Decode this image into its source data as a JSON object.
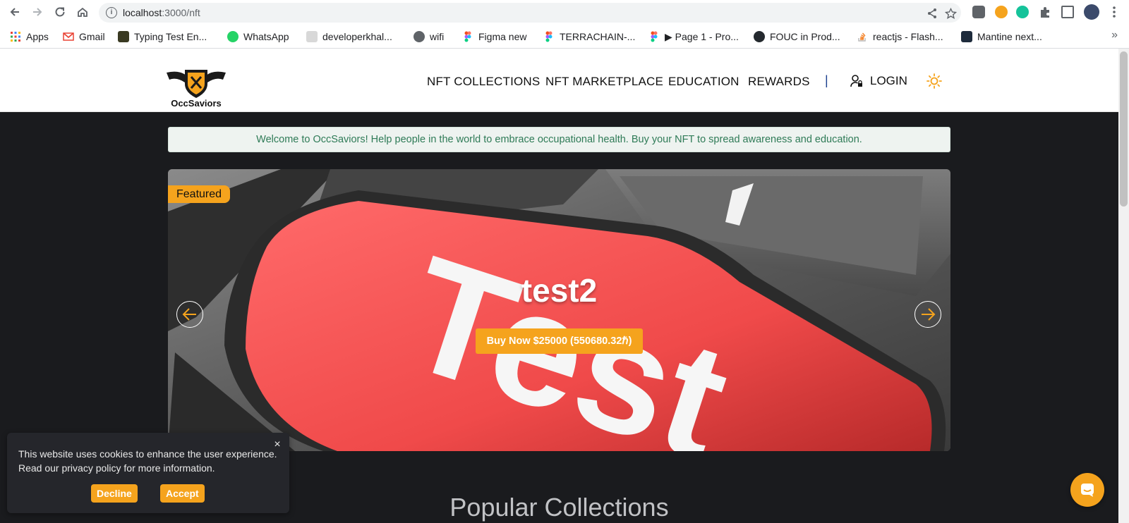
{
  "browser": {
    "url_host": "localhost",
    "url_path": ":3000/nft",
    "bookmarks": [
      {
        "label": "Apps",
        "icon": "apps-grid-icon",
        "color": "#4285f4"
      },
      {
        "label": "Gmail",
        "icon": "gmail-icon",
        "color": "#ea4335"
      },
      {
        "label": "Typing Test En...",
        "icon": "typing-test-icon",
        "color": "#333333"
      },
      {
        "label": "WhatsApp",
        "icon": "whatsapp-icon",
        "color": "#25d366"
      },
      {
        "label": "developerkhal...",
        "icon": "developer-icon",
        "color": "#555555"
      },
      {
        "label": "wifi",
        "icon": "globe-icon",
        "color": "#5f6368"
      },
      {
        "label": "Figma new",
        "icon": "figma-icon",
        "color": "#f24e1e"
      },
      {
        "label": "TERRACHAIN-...",
        "icon": "figma-icon",
        "color": "#f24e1e"
      },
      {
        "label": "▶ Page 1 - Pro...",
        "icon": "figma-icon",
        "color": "#f24e1e"
      },
      {
        "label": "FOUC in Prod...",
        "icon": "github-icon",
        "color": "#24292e"
      },
      {
        "label": "reactjs - Flash...",
        "icon": "stackoverflow-icon",
        "color": "#f48024"
      },
      {
        "label": "Mantine next...",
        "icon": "react-icon",
        "color": "#339af0"
      }
    ]
  },
  "header": {
    "logo_text": "OccSaviors",
    "menu": [
      "NFT COLLECTIONS",
      "NFT MARKETPLACE",
      "EDUCATION",
      "REWARDS"
    ],
    "divider": "|",
    "login_label": "LOGIN"
  },
  "welcome_banner": "Welcome to OccSaviors! Help people in the world to embrace occupational health. Buy your NFT to spread awareness and education.",
  "hero": {
    "badge": "Featured",
    "title": "test2",
    "buy_label": "Buy Now $25000 (550680.32ℏ)",
    "image_text": "Test"
  },
  "section_title": "Popular Collections",
  "cookie_banner": {
    "text": "This website uses cookies to enhance the user experience. Read our privacy policy for more information.",
    "close": "×",
    "decline_label": "Decline",
    "accept_label": "Accept"
  },
  "colors": {
    "accent": "#f5a31d",
    "page_bg": "#1a1b1e",
    "welcome_text": "#2f7b57"
  }
}
